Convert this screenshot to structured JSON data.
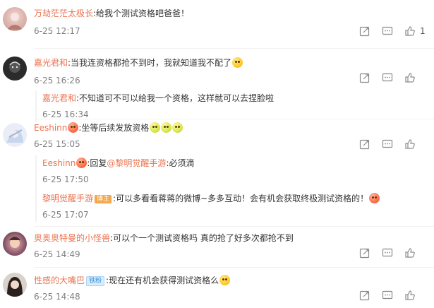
{
  "comments": [
    {
      "user": "万劫茫茫太极长",
      "text": ":给我个测试资格吧爸爸！",
      "time": "6-25 12:17",
      "like_count": "1"
    },
    {
      "user": "嘉光君和",
      "text": ":当我连资格都抢不到时，我就知道我不配了",
      "time": "6-25 16:26",
      "reply": {
        "user": "嘉光君和",
        "text": ":不知道可不可以给我一个资格，这样就可以去捏脸啦",
        "time": "6-25 16:34"
      }
    },
    {
      "user": "Eeshinn",
      "text": ":坐等后续发放资格",
      "time": "6-25 15:05",
      "replies": [
        {
          "user": "Eeshinn",
          "mid": ":回复",
          "mention": "@黎明觉醒手游",
          "text": ":必须滴",
          "time": "6-25 17:50"
        },
        {
          "user": "黎明觉醒手游",
          "badge": "博主",
          "text": ":可以多看看蒋蒋的微博~多多互动！会有机会获取终极测试资格的！",
          "time": "6-25 17:07"
        }
      ]
    },
    {
      "user": "奥奥奥特曼的小怪兽",
      "text": ":可以个一个测试资格吗 真的抢了好多次都抢不到",
      "time": "6-25 14:49"
    },
    {
      "user": "性感的大嘴巴",
      "badge": "铁粉",
      "text": ":现在还有机会获得测试资格么",
      "time": "6-25 14:48"
    }
  ],
  "colors": {
    "username": "#eb7350",
    "time": "#808080",
    "icon": "#8a8a8a"
  },
  "icons": [
    "forward-icon",
    "comment-icon",
    "like-icon"
  ]
}
